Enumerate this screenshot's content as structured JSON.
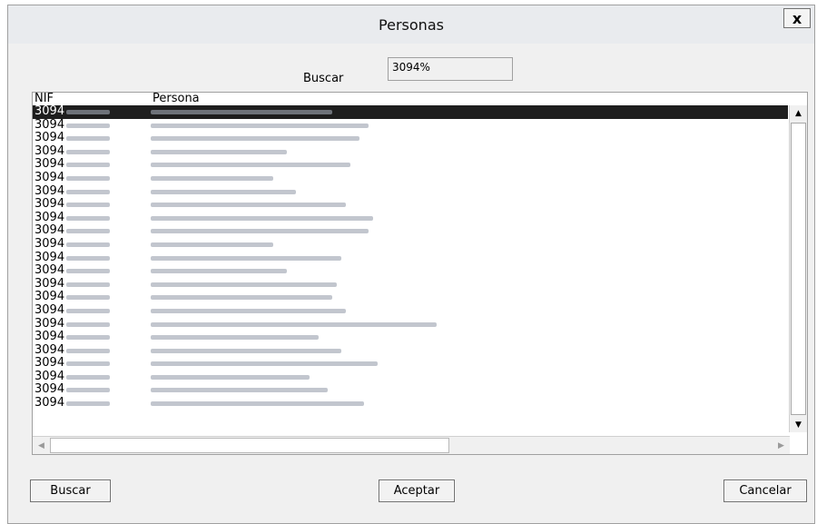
{
  "window": {
    "title": "Personas",
    "close_label": "x"
  },
  "search": {
    "label": "Buscar",
    "value": "3094%"
  },
  "table": {
    "columns": [
      "NIF",
      "Persona"
    ],
    "selected_index": 0,
    "rows": [
      {
        "nif": "3094",
        "name_len": 200
      },
      {
        "nif": "3094",
        "name_len": 240
      },
      {
        "nif": "3094",
        "name_len": 230
      },
      {
        "nif": "3094",
        "name_len": 150
      },
      {
        "nif": "3094",
        "name_len": 220
      },
      {
        "nif": "3094",
        "name_len": 135
      },
      {
        "nif": "3094",
        "name_len": 160
      },
      {
        "nif": "3094",
        "name_len": 215
      },
      {
        "nif": "3094",
        "name_len": 245
      },
      {
        "nif": "3094",
        "name_len": 240
      },
      {
        "nif": "3094",
        "name_len": 135
      },
      {
        "nif": "3094",
        "name_len": 210
      },
      {
        "nif": "3094",
        "name_len": 150
      },
      {
        "nif": "3094",
        "name_len": 205
      },
      {
        "nif": "3094",
        "name_len": 200
      },
      {
        "nif": "3094",
        "name_len": 215
      },
      {
        "nif": "3094",
        "name_len": 315
      },
      {
        "nif": "3094",
        "name_len": 185
      },
      {
        "nif": "3094",
        "name_len": 210
      },
      {
        "nif": "3094",
        "name_len": 250
      },
      {
        "nif": "3094",
        "name_len": 175
      },
      {
        "nif": "3094",
        "name_len": 195
      },
      {
        "nif": "3094",
        "name_len": 235
      }
    ]
  },
  "buttons": {
    "buscar": "Buscar",
    "aceptar": "Aceptar",
    "cancelar": "Cancelar"
  },
  "icons": {
    "close": "close-icon",
    "scroll_up": "arrow-up-icon",
    "scroll_down": "arrow-down-icon",
    "scroll_left": "arrow-left-icon",
    "scroll_right": "arrow-right-icon"
  },
  "colors": {
    "window_bg": "#f0f0f0",
    "selected_row": "#1e1e1e",
    "selected_text": "#ffffff"
  }
}
